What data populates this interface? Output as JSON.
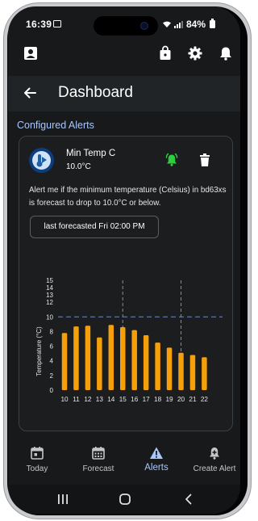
{
  "status_bar": {
    "time": "16:39",
    "battery": "84%",
    "icons": [
      "photo-icon",
      "wifi-icon",
      "signal-icon",
      "battery-icon"
    ]
  },
  "top_bar": {
    "icons": [
      "account-box-icon",
      "shopping-bag-icon",
      "gear-icon",
      "bell-icon"
    ]
  },
  "header": {
    "title": "Dashboard",
    "back_icon": "arrow-left-icon"
  },
  "section": {
    "title": "Configured Alerts"
  },
  "alert": {
    "name": "Min Temp C",
    "value": "10.0°C",
    "description": "Alert me if the minimum temperature (Celsius) in bd63xs is forecast to drop to 10.0°C or below.",
    "last_forecasted": "last forecasted Fri 02:00 PM",
    "bell_color": "#2ecc40",
    "icons": [
      "thermometer-avatar-icon",
      "bell-ring-icon",
      "trash-icon"
    ]
  },
  "chart_data": {
    "type": "bar",
    "categories": [
      "10",
      "11",
      "12",
      "13",
      "14",
      "15",
      "16",
      "17",
      "18",
      "19",
      "20",
      "21",
      "22"
    ],
    "values": [
      7.8,
      8.7,
      8.8,
      7.2,
      8.9,
      8.6,
      8.2,
      7.5,
      6.5,
      5.8,
      5.1,
      4.8,
      4.5
    ],
    "ylabel": "Temperature (°C)",
    "xlabel": "",
    "ylim": [
      0,
      15
    ],
    "yticks": [
      0,
      2,
      4,
      6,
      8,
      10,
      12,
      13,
      14,
      15
    ],
    "threshold": 10,
    "marker_x": [
      "15",
      "20"
    ],
    "bar_color": "#f59f0b",
    "threshold_color": "#6b7db3"
  },
  "bottom_nav": {
    "items": [
      {
        "label": "Today",
        "icon": "calendar-day-icon",
        "active": false
      },
      {
        "label": "Forecast",
        "icon": "calendar-grid-icon",
        "active": false
      },
      {
        "label": "Alerts",
        "icon": "warning-icon",
        "active": true
      },
      {
        "label": "Create Alert",
        "icon": "bell-plus-icon",
        "active": false
      }
    ]
  },
  "system_nav": {
    "icons": [
      "recents-icon",
      "home-icon",
      "back-icon"
    ]
  }
}
